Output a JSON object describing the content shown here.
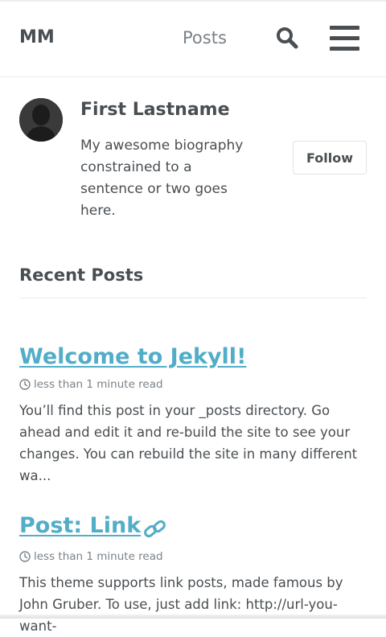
{
  "header": {
    "brand": "MM",
    "nav_posts": "Posts"
  },
  "author": {
    "name": "First Lastname",
    "bio": "My awesome biography constrained to a sentence or two goes here.",
    "follow_label": "Follow"
  },
  "section": {
    "title": "Recent Posts"
  },
  "posts": [
    {
      "title": "Welcome to Jekyll!",
      "read_time": "less than 1 minute read",
      "excerpt": "You’ll find this post in your _posts directory. Go ahead and edit it and re-build the site to see your changes. You can rebuild the site in many different wa..."
    },
    {
      "title": "Post: Link ",
      "read_time": "less than 1 minute read",
      "excerpt": "This theme supports link posts, made famous by John Gruber. To use, just add link: http://url-you-want-"
    }
  ],
  "icons": {
    "search": "search-icon",
    "menu": "hamburger-menu-icon",
    "link": "link-icon",
    "clock": "clock-icon",
    "avatar": "avatar-silhouette"
  },
  "colors": {
    "link": "#52adc8",
    "text": "#494e52",
    "muted": "#7a8288"
  }
}
